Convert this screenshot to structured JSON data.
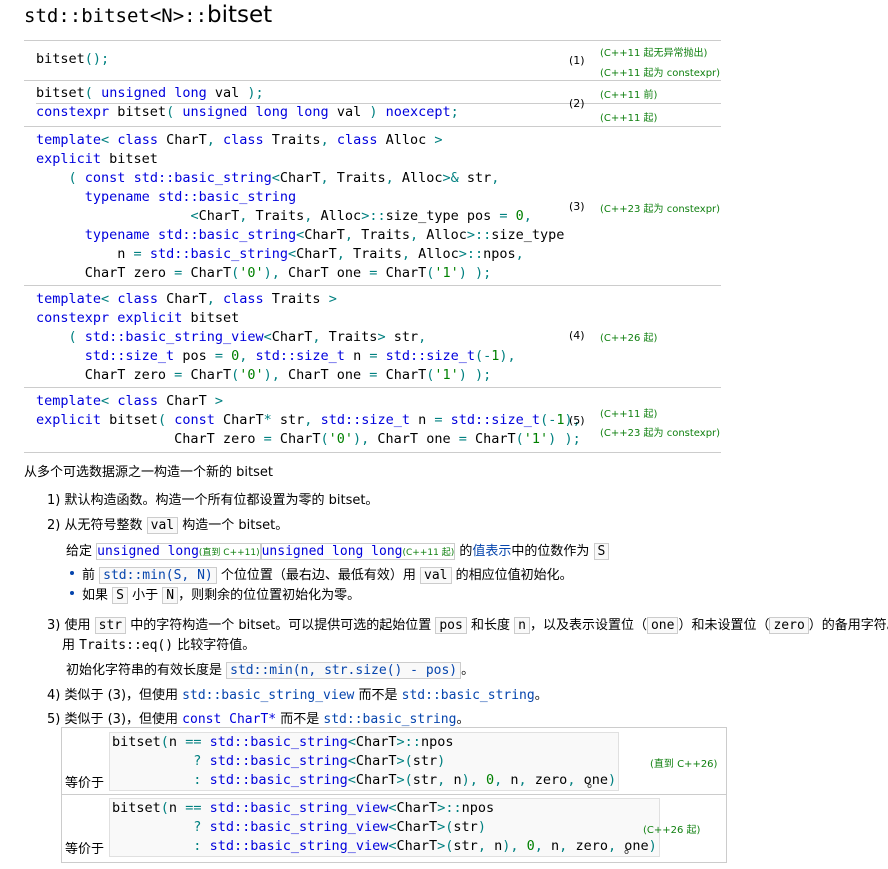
{
  "title": {
    "prefix": "std::bitset<N>::",
    "name": "bitset"
  },
  "overloads": [
    {
      "num": "(1)",
      "ver1": "(C++11 起无异常抛出)",
      "ver2": "(C++11 起为 constexpr)"
    },
    {
      "num": "(2)",
      "ver1": "(C++11 前)",
      "ver2": "(C++11 起)"
    },
    {
      "num": "(3)",
      "ver1": "(C++23 起为 constexpr)"
    },
    {
      "num": "(4)",
      "ver1": "(C++26 起)"
    },
    {
      "num": "(5)",
      "ver1": "(C++11 起)",
      "ver2": "(C++23 起为 constexpr)"
    }
  ],
  "desc": {
    "intro": "从多个可选数据源之一构造一个新的 bitset",
    "i1": "1) 默认构造函数。构造一个所有位都设置为零的 bitset。",
    "i2a": "2) 从无符号整数",
    "i2b": "val",
    "i2c": "构造一个 bitset。",
    "g1": "给定",
    "g_ul": "unsigned long",
    "g_until": "(直到 C++11)",
    "g_ull": "unsigned long long",
    "g_since": "(C++11 起)",
    "g2": "的",
    "g_link": "值表示",
    "g3": "中的位数作为",
    "g_S": "S",
    "b1a": "前",
    "b1b": "std::min(S, N)",
    "b1c": "个位位置（最右边、最低有效）用",
    "b1d": "val",
    "b1e": "的相应位值初始化。",
    "b2a": "如果",
    "b2b": "S",
    "b2c": "小于",
    "b2d": "N",
    "b2e": "，则剩余的位位置初始化为零。",
    "i3a": "3) 使用",
    "i3b": "str",
    "i3c": "中的字符构造一个 bitset。可以提供可选的起始位置",
    "i3d": "pos",
    "i3e": "和长度",
    "i3f": "n",
    "i3g": "，以及表示设置位（",
    "i3h": "one",
    "i3i": "）和未设置位（",
    "i3j": "zero",
    "i3k": "）的备用字符。使",
    "i3l": "用",
    "i3m": "Traits::eq()",
    "i3n": "比较字符值。",
    "i3o": "初始化字符串的有效长度是",
    "i3p": "std::min(n, str.size() - pos)",
    "i3q": "。",
    "i4a": "4) 类似于 (3)，但使用",
    "i4b": "std::basic_string_view",
    "i4c": "而不是",
    "i4d": "std::basic_string",
    "i4e": "。",
    "i5a": "5) 类似于 (3)，但使用",
    "i5b": "const CharT*",
    "i5c": "而不是",
    "i5d": "std::basic_string",
    "i5e": "。"
  },
  "equiv": [
    {
      "label": "等价于",
      "ver": "(直到 C++26)"
    },
    {
      "label": "等价于",
      "ver": "(C++26 起)"
    }
  ]
}
